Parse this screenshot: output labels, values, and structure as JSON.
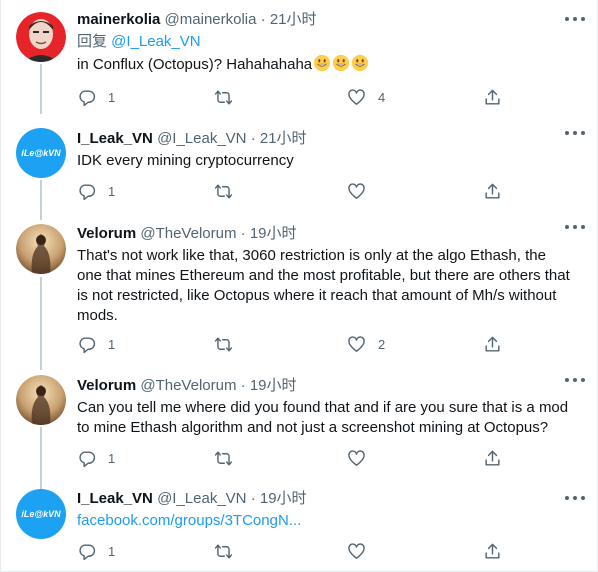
{
  "tweets": [
    {
      "name": "mainerkolia",
      "handle": "@mainerkolia",
      "dot": "·",
      "time": "21小时",
      "reply_prefix": "回复 ",
      "reply_mention": "@I_Leak_VN",
      "text": "in Conflux (Octopus)? Hahahahaha",
      "emoji": "grinning-face",
      "replies": "1",
      "retweets": "",
      "likes": "4"
    },
    {
      "name": "I_Leak_VN",
      "handle": "@I_Leak_VN",
      "dot": "·",
      "time": "21小时",
      "text": "IDK every mining cryptocurrency",
      "avatar_text": "iLe@kVN",
      "replies": "1",
      "retweets": "",
      "likes": ""
    },
    {
      "name": "Velorum",
      "handle": "@TheVelorum",
      "dot": "·",
      "time": "19小时",
      "text": "That's not work like that, 3060 restriction is only at the algo Ethash, the one that mines Ethereum and the most profitable, but there are others that is not restricted, like Octopus where it reach that amount of Mh/s without mods.",
      "replies": "1",
      "retweets": "",
      "likes": "2"
    },
    {
      "name": "Velorum",
      "handle": "@TheVelorum",
      "dot": "·",
      "time": "19小时",
      "text": "Can you tell me where did you found that and if are you sure that is a mod to mine Ethash algorithm and not just a screenshot mining at Octopus?",
      "replies": "1",
      "retweets": "",
      "likes": ""
    },
    {
      "name": "I_Leak_VN",
      "handle": "@I_Leak_VN",
      "dot": "·",
      "time": "19小时",
      "link": "facebook.com/groups/3TCongN...",
      "avatar_text": "iLe@kVN",
      "replies": "1",
      "retweets": "",
      "likes": ""
    }
  ],
  "colors": {
    "accent": "#1d9bf0",
    "secondary_text": "#536471",
    "thread_line": "#c4cfd6",
    "ileak_avatar": "#1da1f2"
  }
}
